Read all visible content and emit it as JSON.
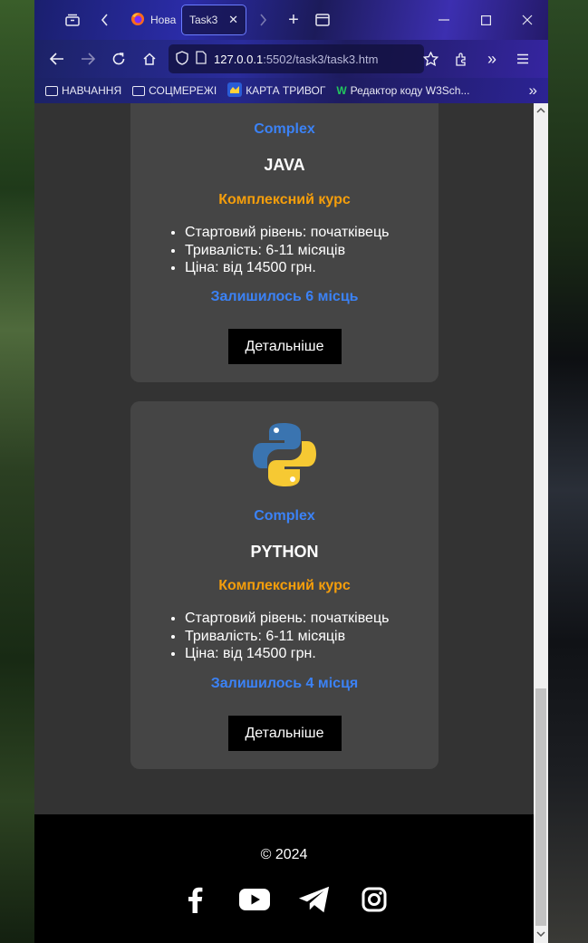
{
  "browser": {
    "tabs": [
      {
        "label": "Нова"
      },
      {
        "label": "Task3"
      }
    ],
    "url_host": "127.0.0.1",
    "url_rest": ":5502/task3/task3.htm",
    "bookmarks": [
      {
        "label": "НАВЧАННЯ"
      },
      {
        "label": "СОЦМЕРЕЖІ"
      },
      {
        "label": "КАРТА ТРИВОГ"
      },
      {
        "label": "Редактор коду W3Sch..."
      }
    ]
  },
  "cards": [
    {
      "type": "Complex",
      "title": "JAVA",
      "subtitle": "Комплексний курс",
      "features": [
        "Стартовий рівень: початківець",
        "Тривалість: 6-11 місяців",
        "Ціна: від 14500 грн."
      ],
      "seats": "Залишилось 6 місць",
      "button": "Детальніше"
    },
    {
      "type": "Complex",
      "title": "PYTHON",
      "subtitle": "Комплексний курс",
      "features": [
        "Стартовий рівень: початківець",
        "Тривалість: 6-11 місяців",
        "Ціна: від 14500 грн."
      ],
      "seats": "Залишилось 4 місця",
      "button": "Детальніше"
    }
  ],
  "footer": {
    "copyright": "© 2024",
    "socials": [
      "facebook-icon",
      "youtube-icon",
      "telegram-icon",
      "instagram-icon"
    ]
  },
  "colors": {
    "accent_blue": "#3b82f6",
    "accent_orange": "#f59e0b",
    "card_bg": "#454545",
    "page_bg": "#333333"
  }
}
